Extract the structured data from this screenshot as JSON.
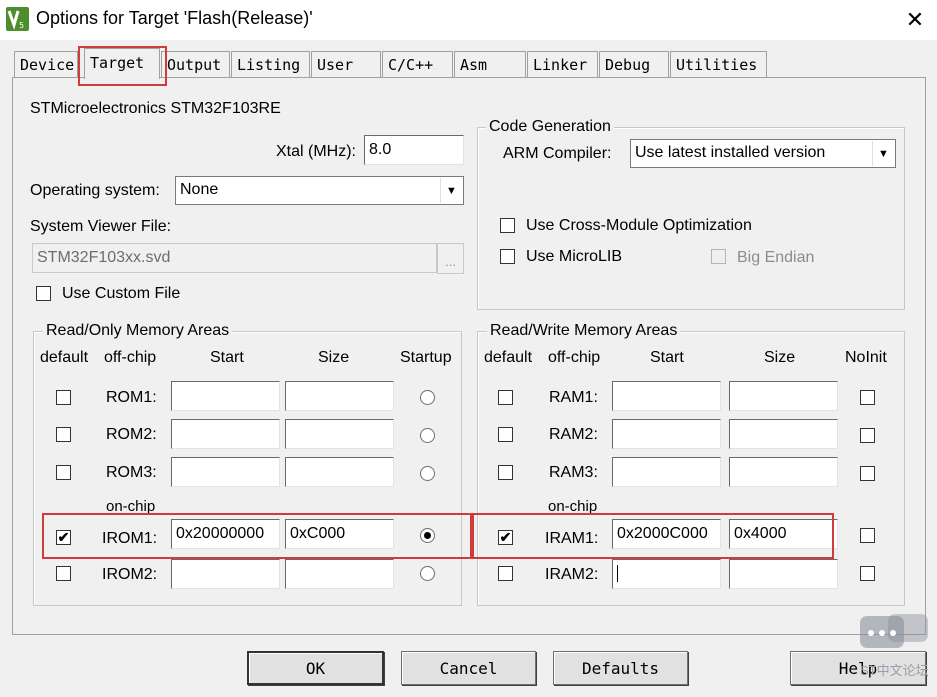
{
  "window": {
    "title": "Options for Target 'Flash(Release)'",
    "close_glyph": "✕"
  },
  "tabs": [
    {
      "label": "Device"
    },
    {
      "label": "Target"
    },
    {
      "label": "Output"
    },
    {
      "label": "Listing"
    },
    {
      "label": "User"
    },
    {
      "label": "C/C++"
    },
    {
      "label": "Asm"
    },
    {
      "label": "Linker"
    },
    {
      "label": "Debug"
    },
    {
      "label": "Utilities"
    }
  ],
  "device_name": "STMicroelectronics STM32F103RE",
  "xtal": {
    "label": "Xtal (MHz):",
    "value": "8.0"
  },
  "os": {
    "label": "Operating system:",
    "value": "None"
  },
  "svd": {
    "label": "System Viewer File:",
    "value": "STM32F103xx.svd",
    "browse": "..."
  },
  "custom_file": {
    "label": "Use Custom File",
    "checked": false
  },
  "codegen": {
    "title": "Code Generation",
    "compiler_label": "ARM Compiler:",
    "compiler_value": "Use latest installed version",
    "cross_module": "Use Cross-Module Optimization",
    "microlib": "Use MicroLIB",
    "big_endian": "Big Endian"
  },
  "ro": {
    "title": "Read/Only Memory Areas",
    "headers": {
      "default": "default",
      "offchip": "off-chip",
      "start": "Start",
      "size": "Size",
      "extra": "Startup"
    },
    "onchip_label": "on-chip",
    "rows": [
      {
        "name": "ROM1:",
        "checked": false,
        "start": "",
        "size": "",
        "radio": false
      },
      {
        "name": "ROM2:",
        "checked": false,
        "start": "",
        "size": "",
        "radio": false
      },
      {
        "name": "ROM3:",
        "checked": false,
        "start": "",
        "size": "",
        "radio": false
      },
      {
        "name": "IROM1:",
        "checked": true,
        "start": "0x20000000",
        "size": "0xC000",
        "radio": true
      },
      {
        "name": "IROM2:",
        "checked": false,
        "start": "",
        "size": "",
        "radio": false
      }
    ]
  },
  "rw": {
    "title": "Read/Write Memory Areas",
    "headers": {
      "default": "default",
      "offchip": "off-chip",
      "start": "Start",
      "size": "Size",
      "extra": "NoInit"
    },
    "onchip_label": "on-chip",
    "rows": [
      {
        "name": "RAM1:",
        "checked": false,
        "start": "",
        "size": ""
      },
      {
        "name": "RAM2:",
        "checked": false,
        "start": "",
        "size": ""
      },
      {
        "name": "RAM3:",
        "checked": false,
        "start": "",
        "size": ""
      },
      {
        "name": "IRAM1:",
        "checked": true,
        "start": "0x2000C000",
        "size": "0x4000"
      },
      {
        "name": "IRAM2:",
        "checked": false,
        "start": "",
        "size": ""
      }
    ]
  },
  "buttons": {
    "ok": "OK",
    "cancel": "Cancel",
    "defaults": "Defaults",
    "help": "Help"
  },
  "watermark": "ST中文论坛",
  "colors": {
    "highlight": "#d23b3b",
    "dialog_bg": "#f0f0f0"
  }
}
